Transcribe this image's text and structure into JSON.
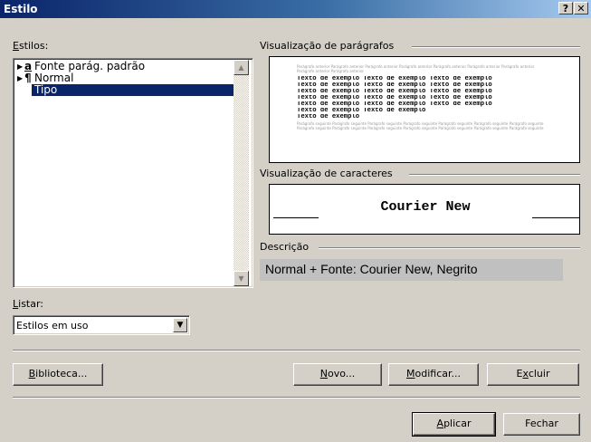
{
  "window": {
    "title": "Estilo",
    "help_label": "?",
    "close_label": "✕"
  },
  "styles": {
    "label_accel": "E",
    "label_rest": "stilos:",
    "items": [
      {
        "glyph": "a",
        "label": "Fonte parág. padrão",
        "selected": false
      },
      {
        "glyph": "¶",
        "label": "Normal",
        "selected": false
      },
      {
        "glyph": "¶",
        "label": "Tipo",
        "selected": true
      }
    ],
    "list_label_accel": "L",
    "list_label_rest": "istar:",
    "list_value": "Estilos em uso"
  },
  "paragraph_preview": {
    "label": "Visualização de parágrafos",
    "previous_text": "Parágrafo anterior Parágrafo anterior Parágrafo anterior Parágrafo anterior Parágrafo anterior Parágrafo anterior Parágrafo anterior Parágrafo anterior Parágrafo anterior",
    "sample_lines": [
      "Texto de exemplo Texto de exemplo Texto de exemplo",
      "Texto de exemplo Texto de exemplo Texto de exemplo",
      "Texto de exemplo Texto de exemplo Texto de exemplo",
      "Texto de exemplo Texto de exemplo Texto de exemplo",
      "Texto de exemplo Texto de exemplo Texto de exemplo",
      "Texto de exemplo Texto de exemplo",
      "Texto de exemplo"
    ],
    "next_text": "Parágrafo seguinte Parágrafo seguinte Parágrafo seguinte Parágrafo seguinte Parágrafo seguinte Parágrafo seguinte Parágrafo seguinte Parágrafo seguinte Parágrafo seguinte Parágrafo seguinte Parágrafo seguinte Parágrafo seguinte Parágrafo seguinte Parágrafo seguinte"
  },
  "character_preview": {
    "label": "Visualização de caracteres",
    "text": "Courier New"
  },
  "description": {
    "label": "Descrição",
    "text": "Normal + Fonte: Courier New, Negrito"
  },
  "buttons": {
    "library": {
      "accel": "B",
      "rest": "iblioteca..."
    },
    "new": {
      "accel": "N",
      "rest": "ovo..."
    },
    "modify": {
      "accel": "M",
      "rest": "odificar..."
    },
    "delete": {
      "pre": "E",
      "accel": "x",
      "rest": "cluir"
    },
    "apply": {
      "accel": "A",
      "rest": "plicar"
    },
    "close": {
      "label": "Fechar"
    }
  }
}
